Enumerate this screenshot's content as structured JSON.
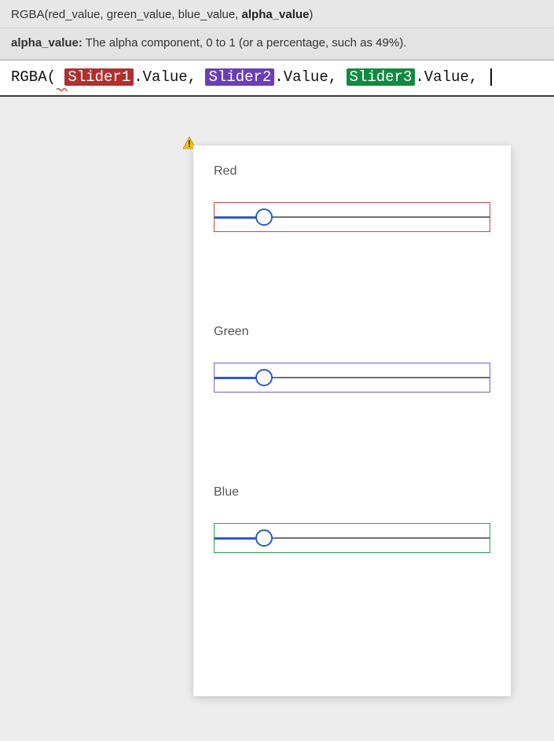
{
  "intellisense": {
    "signature_prefix": "RGBA(red_value, green_value, blue_value, ",
    "signature_current": "alpha_value",
    "signature_suffix": ")"
  },
  "hint": {
    "key": "alpha_value:",
    "text": " The alpha component, 0 to 1 (or a percentage, such as 49%)."
  },
  "formula": {
    "func": "RGBA",
    "open": "(",
    "space": " ",
    "token1": "Slider1",
    "token2": "Slider2",
    "token3": "Slider3",
    "prop": ".Value",
    "sep": ", ",
    "token1_color": "#B03030",
    "token2_color": "#6A3FB5",
    "token3_color": "#108A3E"
  },
  "sliders": [
    {
      "label": "Red",
      "border_class": "box-red",
      "value_pct": 18
    },
    {
      "label": "Green",
      "border_class": "box-purple",
      "value_pct": 18
    },
    {
      "label": "Blue",
      "border_class": "box-green",
      "value_pct": 18
    }
  ]
}
